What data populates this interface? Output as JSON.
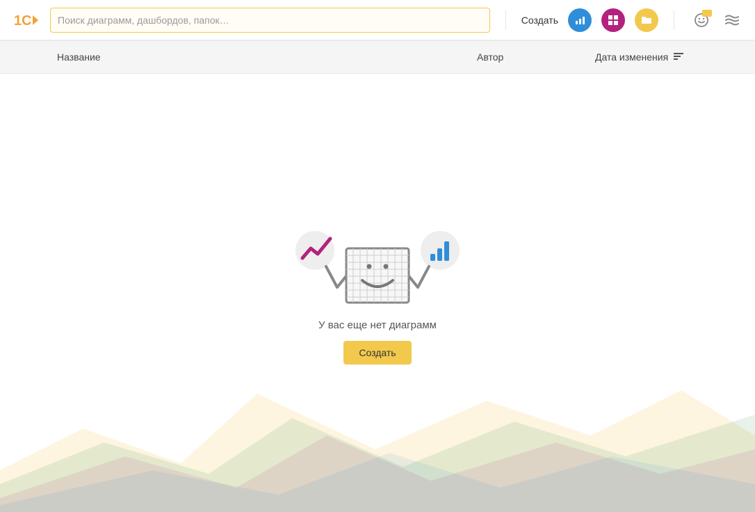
{
  "header": {
    "search_placeholder": "Поиск диаграмм, дашбордов, папок…",
    "create_label": "Создать"
  },
  "columns": {
    "name": "Название",
    "author": "Автор",
    "date": "Дата изменения"
  },
  "empty": {
    "message": "У вас еще нет диаграмм",
    "create_label": "Создать"
  },
  "colors": {
    "accent_blue": "#2f8ed9",
    "accent_magenta": "#b3227e",
    "accent_yellow": "#f2c94c"
  }
}
